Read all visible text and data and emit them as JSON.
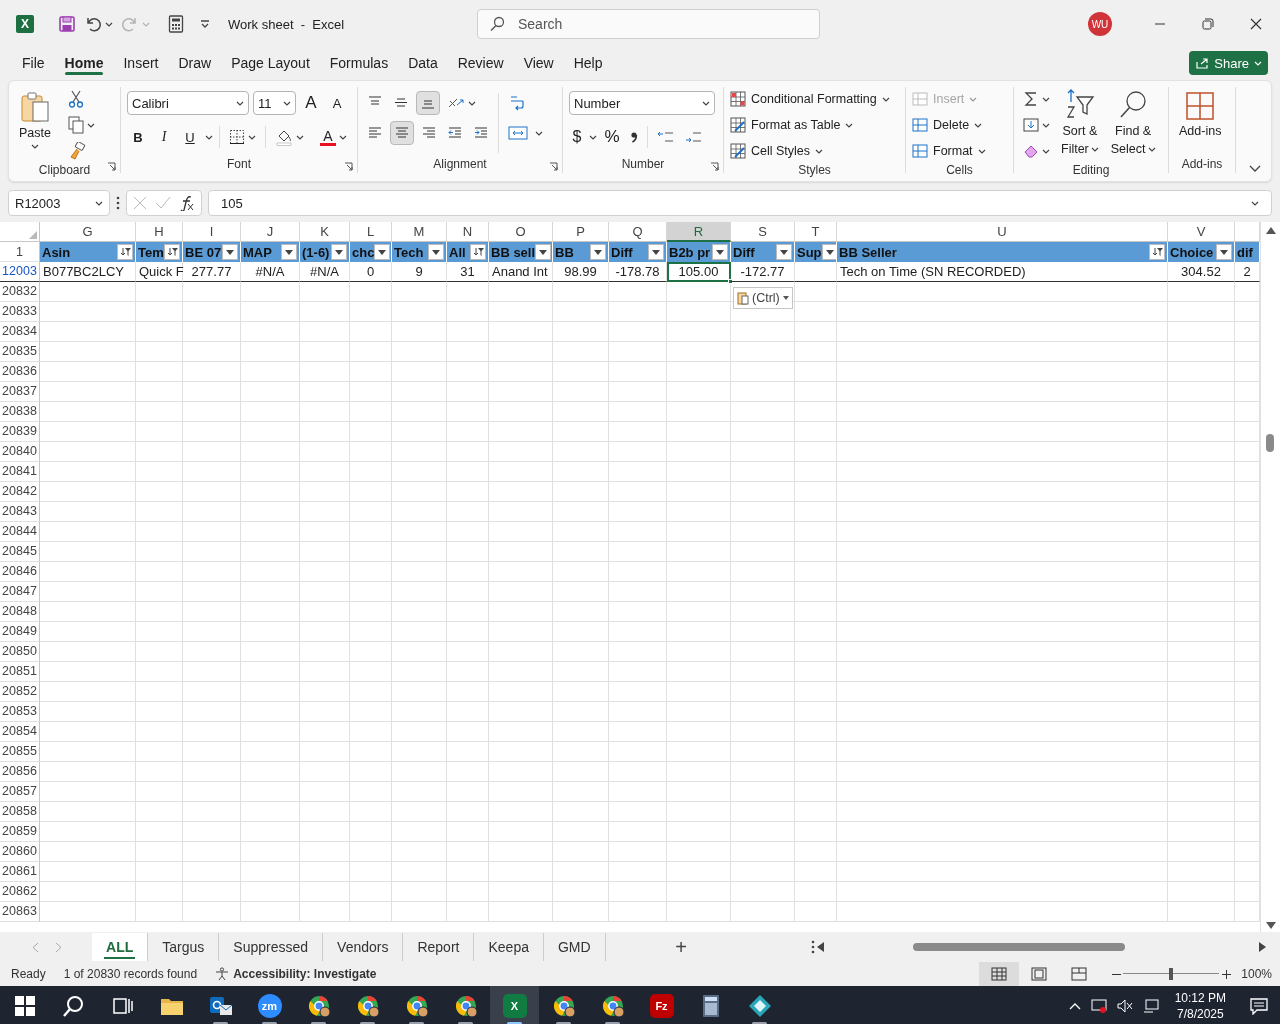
{
  "title_bar": {
    "app_letter": "X",
    "title": "Work sheet  -  Excel",
    "search_placeholder": "Search",
    "avatar_initials": "WU",
    "redo_disabled": true
  },
  "ribbon_tabs": [
    {
      "label": "File",
      "selected": false
    },
    {
      "label": "Home",
      "selected": true
    },
    {
      "label": "Insert",
      "selected": false
    },
    {
      "label": "Draw",
      "selected": false
    },
    {
      "label": "Page Layout",
      "selected": false
    },
    {
      "label": "Formulas",
      "selected": false
    },
    {
      "label": "Data",
      "selected": false
    },
    {
      "label": "Review",
      "selected": false
    },
    {
      "label": "View",
      "selected": false
    },
    {
      "label": "Help",
      "selected": false
    }
  ],
  "share_button": "Share",
  "ribbon": {
    "clipboard": {
      "label": "Clipboard",
      "paste": "Paste"
    },
    "font": {
      "label": "Font",
      "name": "Calibri",
      "size": "11",
      "grow": "A",
      "shrink": "A",
      "bold": "B",
      "italic": "I",
      "underline": "U",
      "color_glyph": "A"
    },
    "alignment": {
      "label": "Alignment",
      "buttons": [
        {
          "kind": "top",
          "selected": false
        },
        {
          "kind": "middle",
          "selected": false
        },
        {
          "kind": "bottom",
          "selected": true
        },
        {
          "kind": "left",
          "selected": false
        },
        {
          "kind": "center",
          "selected": true
        },
        {
          "kind": "right",
          "selected": false
        },
        {
          "kind": "outdent",
          "selected": false
        },
        {
          "kind": "indent",
          "selected": false
        }
      ]
    },
    "number": {
      "label": "Number",
      "format": "Number",
      "currency": "$",
      "percent": "%"
    },
    "styles": {
      "label": "Styles",
      "items": [
        "Conditional Formatting",
        "Format as Table",
        "Cell Styles"
      ]
    },
    "cells": {
      "label": "Cells",
      "items": [
        {
          "label": "Insert",
          "disabled": true
        },
        {
          "label": "Delete",
          "disabled": false
        },
        {
          "label": "Format",
          "disabled": false
        }
      ]
    },
    "editing": {
      "label": "Editing",
      "sort_line1": "Sort &",
      "sort_line2": "Filter",
      "find_line1": "Find &",
      "find_line2": "Select"
    },
    "addins": {
      "label": "Add-ins",
      "button": "Add-ins"
    }
  },
  "formula_bar": {
    "name_box": "R12003",
    "formula": "105"
  },
  "sheet": {
    "columns": [
      {
        "letter": "G",
        "selected": false
      },
      {
        "letter": "H",
        "selected": false
      },
      {
        "letter": "I",
        "selected": false
      },
      {
        "letter": "J",
        "selected": false
      },
      {
        "letter": "K",
        "selected": false
      },
      {
        "letter": "L",
        "selected": false
      },
      {
        "letter": "M",
        "selected": false
      },
      {
        "letter": "N",
        "selected": false
      },
      {
        "letter": "O",
        "selected": false
      },
      {
        "letter": "P",
        "selected": false
      },
      {
        "letter": "Q",
        "selected": false
      },
      {
        "letter": "R",
        "selected": true
      },
      {
        "letter": "S",
        "selected": false
      },
      {
        "letter": "T",
        "selected": false
      },
      {
        "letter": "U",
        "selected": false
      },
      {
        "letter": "V",
        "selected": false
      }
    ],
    "header_row": {
      "number": "1",
      "cells": [
        {
          "text": "Asin",
          "filtered": true
        },
        {
          "text": "Tem",
          "filtered": true
        },
        {
          "text": "BE 07",
          "filtered": false
        },
        {
          "text": "MAP",
          "filtered": false
        },
        {
          "text": "(1-6)",
          "filtered": false
        },
        {
          "text": "chc",
          "filtered": false
        },
        {
          "text": "Tech",
          "filtered": false
        },
        {
          "text": "All",
          "filtered": true
        },
        {
          "text": "BB sell",
          "filtered": false
        },
        {
          "text": "BB",
          "filtered": false
        },
        {
          "text": "Diff",
          "filtered": false
        },
        {
          "text": "B2b pr",
          "filtered": false
        },
        {
          "text": "Diff",
          "filtered": false
        },
        {
          "text": "Sup",
          "filtered": false
        },
        {
          "text": "BB Seller",
          "filtered": true
        },
        {
          "text": "Choice",
          "filtered": false
        },
        {
          "text": "dif"
        }
      ]
    },
    "data_row": {
      "number": "12003",
      "filtered": true,
      "cells": [
        {
          "text": "B077BC2LCY",
          "kind": "text",
          "selected": false
        },
        {
          "text": "Quick F",
          "kind": "text",
          "selected": false
        },
        {
          "text": "277.77",
          "kind": "number",
          "selected": false
        },
        {
          "text": "#N/A",
          "kind": "number",
          "selected": false
        },
        {
          "text": "#N/A",
          "kind": "number",
          "selected": false
        },
        {
          "text": "0",
          "kind": "number",
          "selected": false
        },
        {
          "text": "9",
          "kind": "number",
          "selected": false
        },
        {
          "text": "31",
          "kind": "number",
          "selected": false
        },
        {
          "text": "Anand Int",
          "kind": "text",
          "selected": false
        },
        {
          "text": "98.99",
          "kind": "number",
          "selected": false
        },
        {
          "text": "-178.78",
          "kind": "number",
          "selected": false
        },
        {
          "text": "105.00",
          "kind": "number",
          "selected": true
        },
        {
          "text": "-172.77",
          "kind": "number",
          "selected": false
        },
        {
          "text": "",
          "kind": "text",
          "selected": false
        },
        {
          "text": "Tech on Time (SN RECORDED)",
          "kind": "text",
          "selected": false
        },
        {
          "text": "304.52",
          "kind": "number",
          "selected": false
        },
        {
          "text": "2",
          "kind": "number",
          "selected": false
        }
      ]
    },
    "empty_rows": [
      "20832",
      "20833",
      "20834",
      "20835",
      "20836",
      "20837",
      "20838",
      "20839",
      "20840",
      "20841",
      "20842",
      "20843",
      "20844",
      "20845",
      "20846",
      "20847",
      "20848",
      "20849",
      "20850",
      "20851",
      "20852",
      "20853",
      "20854",
      "20855",
      "20856",
      "20857",
      "20858",
      "20859",
      "20860",
      "20861",
      "20862",
      "20863"
    ],
    "paste_options": "(Ctrl)"
  },
  "sheet_tabs": {
    "tabs": [
      {
        "label": "ALL",
        "selected": true
      },
      {
        "label": "Targus",
        "selected": false
      },
      {
        "label": "Suppressed",
        "selected": false
      },
      {
        "label": "Vendors",
        "selected": false
      },
      {
        "label": "Report",
        "selected": false
      },
      {
        "label": "Keepa",
        "selected": false
      },
      {
        "label": "GMD",
        "selected": false
      }
    ],
    "add": "+"
  },
  "status_bar": {
    "mode": "Ready",
    "records": "1 of 20830 records found",
    "accessibility": "Accessibility: Investigate",
    "views": [
      {
        "kind": "normal",
        "selected": true
      },
      {
        "kind": "page-layout",
        "selected": false
      },
      {
        "kind": "page-break",
        "selected": false
      }
    ],
    "zoom": {
      "level": 0.5,
      "reading": "100%"
    }
  },
  "taskbar": {
    "items": [
      {
        "kind": "start",
        "running": false,
        "active": false
      },
      {
        "kind": "search",
        "running": false,
        "active": false
      },
      {
        "kind": "task-view",
        "running": false,
        "active": false
      },
      {
        "kind": "folder",
        "running": false,
        "active": false
      },
      {
        "kind": "mail",
        "running": true,
        "active": false
      },
      {
        "kind": "zoom",
        "label": "zm",
        "running": true,
        "active": false
      },
      {
        "kind": "browser",
        "running": true,
        "active": false
      },
      {
        "kind": "browser",
        "running": true,
        "active": false
      },
      {
        "kind": "browser",
        "running": true,
        "active": false
      },
      {
        "kind": "browser",
        "running": true,
        "active": false
      },
      {
        "kind": "sheet",
        "label": "X",
        "running": true,
        "active": true
      },
      {
        "kind": "browser",
        "running": true,
        "active": false
      },
      {
        "kind": "browser",
        "running": true,
        "active": false
      },
      {
        "kind": "ftp",
        "label": "Fz",
        "running": false,
        "active": false
      },
      {
        "kind": "calculator",
        "running": false,
        "active": false
      },
      {
        "kind": "diamond",
        "running": true,
        "active": false
      }
    ],
    "time": "10:12 PM",
    "date": "7/8/2025"
  }
}
